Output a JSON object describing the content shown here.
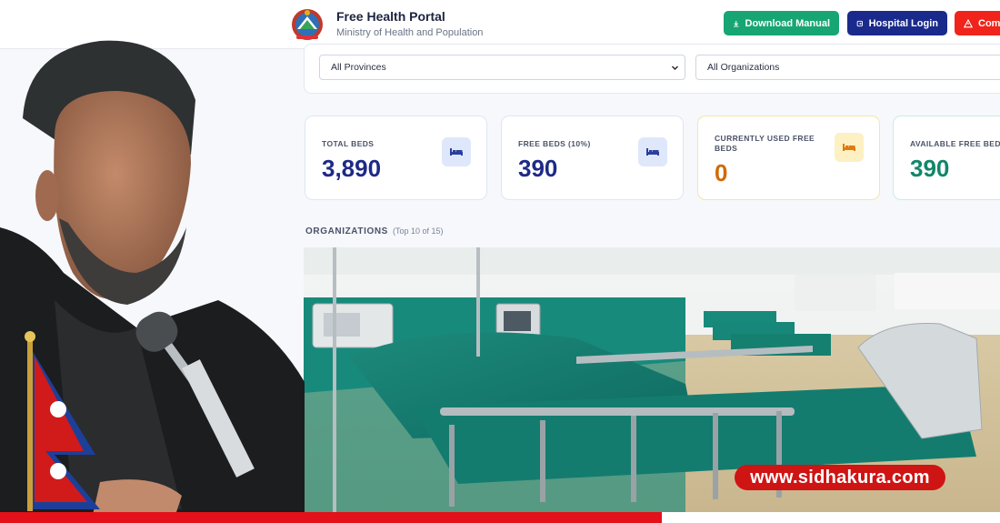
{
  "header": {
    "title": "Free Health Portal",
    "subtitle": "Ministry of Health and Population",
    "buttons": {
      "download": "Download Manual",
      "login": "Hospital Login",
      "complaint": "Com"
    }
  },
  "filters": {
    "province": "All Provinces",
    "organization": "All Organizations"
  },
  "stats": [
    {
      "label": "TOTAL BEDS",
      "value": "3,890",
      "icon": "bed-icon"
    },
    {
      "label": "FREE BEDS (10%)",
      "value": "390",
      "icon": "bed-icon"
    },
    {
      "label": "CURRENTLY USED FREE BEDS",
      "value": "0",
      "icon": "bed-icon"
    },
    {
      "label": "AVAILABLE FREE BEDS",
      "value": "390",
      "icon": "bed-icon"
    }
  ],
  "organizations": {
    "heading": "ORGANIZATIONS",
    "count": "(Top 10 of 15)"
  },
  "watermark": "www.sidhakura.com",
  "colors": {
    "primary": "#1a2a8c",
    "success": "#17a673",
    "danger": "#f0241a",
    "orange": "#d06a0a",
    "teal": "#12866a",
    "brand_red": "#e4101a"
  }
}
